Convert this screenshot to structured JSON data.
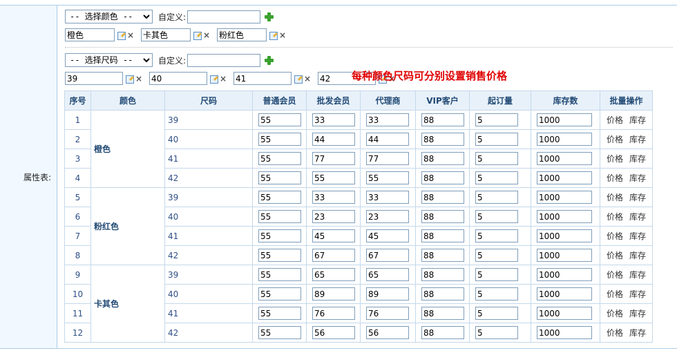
{
  "side_label": "属性表:",
  "color_select": {
    "selected": "-- 选择颜色 --"
  },
  "size_select": {
    "selected": "-- 选择尺码 --"
  },
  "custom_label": "自定义:",
  "colors": [
    "橙色",
    "卡其色",
    "粉红色"
  ],
  "sizes": [
    "39",
    "40",
    "41",
    "42"
  ],
  "note": "每种颜色尺码可分别设置销售价格",
  "table": {
    "headers": [
      "序号",
      "颜色",
      "尺码",
      "普通会员",
      "批发会员",
      "代理商",
      "VIP客户",
      "起订量",
      "库存数",
      "批量操作"
    ],
    "op_price": "价格",
    "op_stock": "库存",
    "groups": [
      {
        "color": "橙色",
        "rows": [
          {
            "idx": "1",
            "size": "39",
            "vals": [
              "55",
              "33",
              "33",
              "88",
              "5",
              "1000"
            ]
          },
          {
            "idx": "2",
            "size": "40",
            "vals": [
              "55",
              "44",
              "44",
              "88",
              "5",
              "1000"
            ]
          },
          {
            "idx": "3",
            "size": "41",
            "vals": [
              "55",
              "77",
              "77",
              "88",
              "5",
              "1000"
            ]
          },
          {
            "idx": "4",
            "size": "42",
            "vals": [
              "55",
              "55",
              "55",
              "88",
              "5",
              "1000"
            ]
          }
        ]
      },
      {
        "color": "粉红色",
        "rows": [
          {
            "idx": "5",
            "size": "39",
            "vals": [
              "55",
              "33",
              "33",
              "88",
              "5",
              "1000"
            ]
          },
          {
            "idx": "6",
            "size": "40",
            "vals": [
              "55",
              "23",
              "23",
              "88",
              "5",
              "1000"
            ]
          },
          {
            "idx": "7",
            "size": "41",
            "vals": [
              "55",
              "45",
              "45",
              "88",
              "5",
              "1000"
            ]
          },
          {
            "idx": "8",
            "size": "42",
            "vals": [
              "55",
              "67",
              "67",
              "88",
              "5",
              "1000"
            ]
          }
        ]
      },
      {
        "color": "卡其色",
        "rows": [
          {
            "idx": "9",
            "size": "39",
            "vals": [
              "55",
              "65",
              "65",
              "88",
              "5",
              "1000"
            ]
          },
          {
            "idx": "10",
            "size": "40",
            "vals": [
              "55",
              "89",
              "89",
              "88",
              "5",
              "1000"
            ]
          },
          {
            "idx": "11",
            "size": "41",
            "vals": [
              "55",
              "76",
              "76",
              "88",
              "5",
              "1000"
            ]
          },
          {
            "idx": "12",
            "size": "42",
            "vals": [
              "55",
              "56",
              "56",
              "88",
              "5",
              "1000"
            ]
          }
        ]
      }
    ]
  },
  "colors_hex": {
    "note": "#e00000",
    "header_bg": "#e8f1fa",
    "header_text": "#234b75",
    "border": "#c4d8ea",
    "plus": "#3aa12e"
  }
}
